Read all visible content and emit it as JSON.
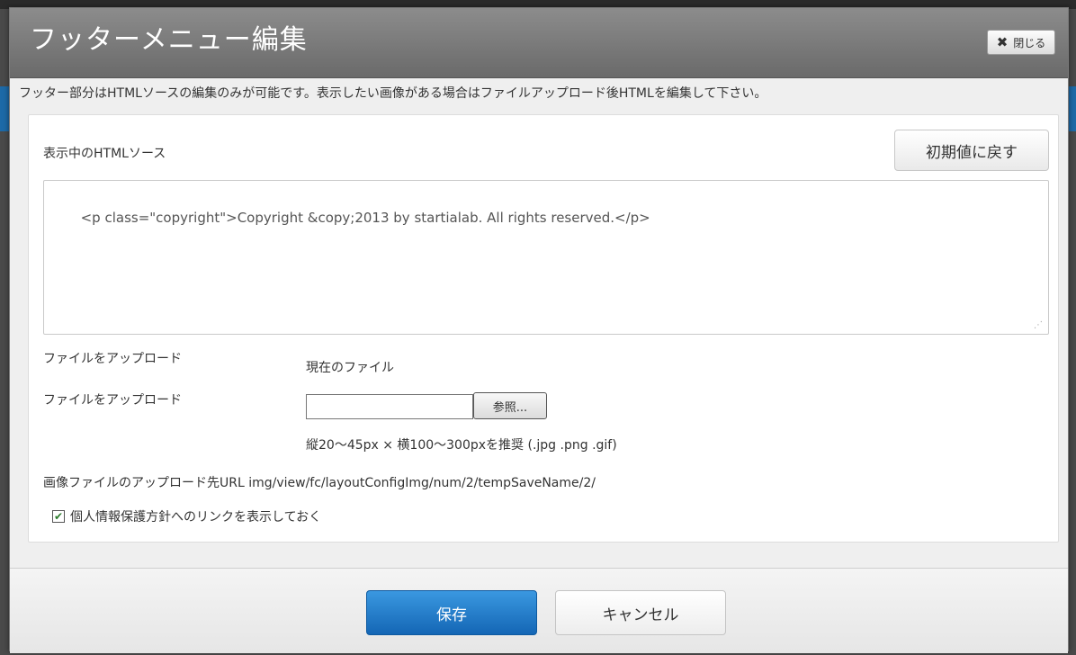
{
  "dialog": {
    "title": "フッターメニュー編集",
    "close_label": "閉じる",
    "close_icon": "close-icon",
    "notice": "フッター部分はHTMLソースの編集のみが可能です。表示したい画像がある場合はファイルアップロード後HTMLを編集して下さい。"
  },
  "source": {
    "label": "表示中のHTMLソース",
    "reset_label": "初期値に戻す",
    "value": "<p class=\"copyright\">Copyright &copy;2013 by startialab. All rights reserved.</p>"
  },
  "upload": {
    "current_label": "ファイルをアップロード",
    "current_value": "現在のファイル",
    "upload_label": "ファイルをアップロード",
    "browse_label": "参照...",
    "hint": "縦20～45px × 横100～300pxを推奨 (.jpg .png .gif)",
    "url_text": "画像ファイルのアップロード先URL img/view/fc/layoutConfigImg/num/2/tempSaveName/2/"
  },
  "privacy": {
    "checked": true,
    "label": "個人情報保護方針へのリンクを表示しておく"
  },
  "footer": {
    "save_label": "保存",
    "cancel_label": "キャンセル"
  },
  "colors": {
    "titlebar": "#7a7a7a",
    "save_button": "#1f78c8"
  }
}
